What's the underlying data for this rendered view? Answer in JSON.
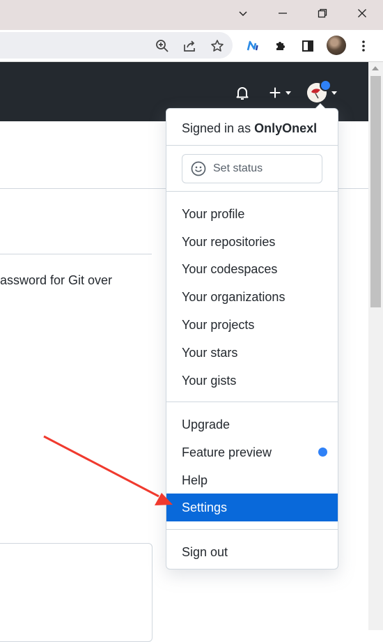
{
  "dropdown": {
    "signed_in_prefix": "Signed in as",
    "username": "OnlyOnexl",
    "set_status": "Set status",
    "items_group1": [
      "Your profile",
      "Your repositories",
      "Your codespaces",
      "Your organizations",
      "Your projects",
      "Your stars",
      "Your gists"
    ],
    "items_group2": [
      "Upgrade",
      "Feature preview",
      "Help",
      "Settings"
    ],
    "sign_out": "Sign out",
    "active_item": "Settings"
  },
  "page": {
    "partial_text": "assword for Git over"
  },
  "colors": {
    "header_bg": "#24292f",
    "active_item_bg": "#0969da",
    "notification_dot": "#2f81f7",
    "annotation_arrow": "#f03a2e"
  },
  "icons": {
    "window_controls": [
      "chevron-down-icon",
      "minimize-icon",
      "restore-icon",
      "close-icon"
    ],
    "toolbar": [
      "zoom-icon",
      "share-icon",
      "star-icon",
      "extension-n-icon",
      "puzzle-icon",
      "sidepanel-icon",
      "profile-avatar",
      "more-icon"
    ],
    "header": [
      "bell-icon",
      "plus-icon",
      "avatar-icon"
    ],
    "status": "smiley-icon"
  }
}
